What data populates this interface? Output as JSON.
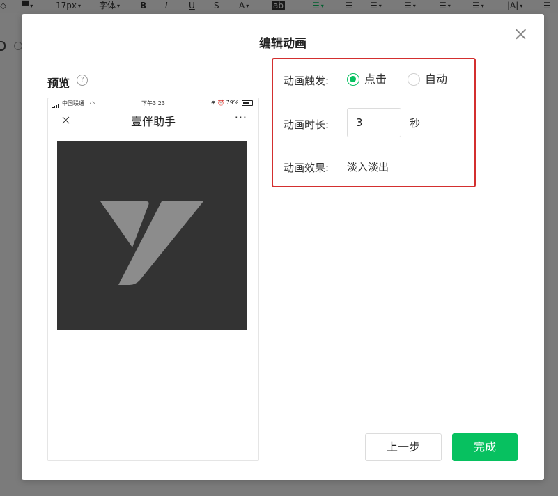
{
  "toolbar": {
    "font_size": "17px",
    "font_family": "字体",
    "bold": "B",
    "italic": "I",
    "underline": "U",
    "strike": "S",
    "font_color": "A",
    "highlight": "ab"
  },
  "modal": {
    "title": "编辑动画"
  },
  "preview": {
    "label": "预览",
    "help_icon": "?",
    "status_bar": {
      "carrier": "中国联通",
      "time": "下午3:23",
      "battery": "79%",
      "battery_level": 0.79
    },
    "nav": {
      "title": "壹伴助手",
      "more": "···"
    }
  },
  "settings": {
    "trigger": {
      "label": "动画触发:",
      "options": [
        {
          "label": "点击",
          "checked": true
        },
        {
          "label": "自动",
          "checked": false
        }
      ]
    },
    "duration": {
      "label": "动画时长:",
      "value": "3",
      "unit": "秒"
    },
    "effect": {
      "label": "动画效果:",
      "value": "淡入淡出"
    }
  },
  "footer": {
    "prev_label": "上一步",
    "done_label": "完成"
  },
  "colors": {
    "accent": "#07c160",
    "highlight_border": "#d32f2f",
    "preview_bg": "#333333",
    "logo": "#8c8c8c"
  }
}
